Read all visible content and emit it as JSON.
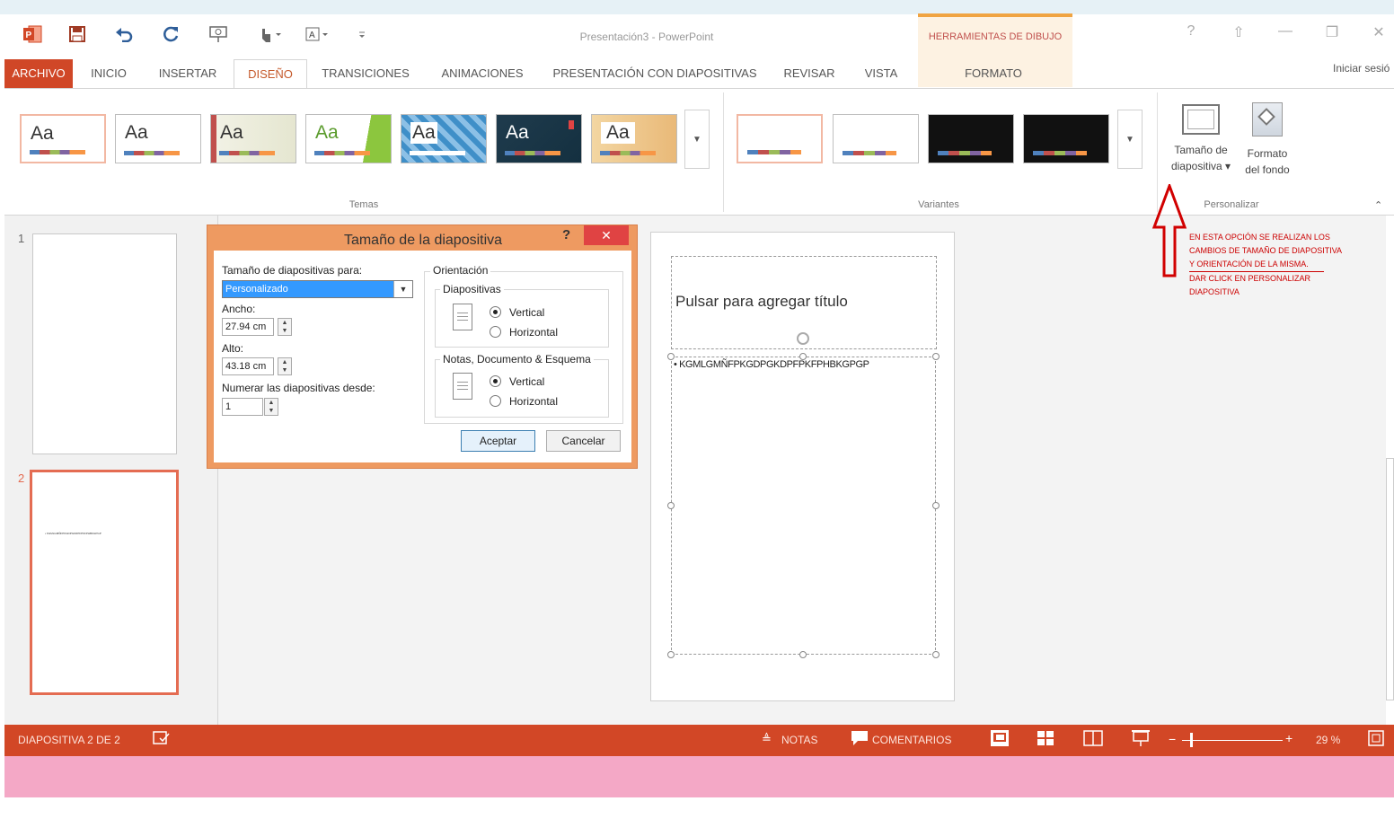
{
  "titlebar": {
    "title": "Presentación3 - PowerPoint",
    "context_group": "HERRAMIENTAS DE DIBUJO",
    "quick_access_icons": [
      "powerpoint-logo-icon",
      "save-icon",
      "undo-icon",
      "redo-icon",
      "start-from-beginning-icon",
      "touch-mode-icon",
      "font-size-icon",
      "customize-qat-icon"
    ],
    "window_buttons": [
      "?",
      "⇧",
      "—",
      "❐",
      "✕"
    ]
  },
  "tabs": [
    "ARCHIVO",
    "INICIO",
    "INSERTAR",
    "DISEÑO",
    "TRANSICIONES",
    "ANIMACIONES",
    "PRESENTACIÓN CON DIAPOSITIVAS",
    "REVISAR",
    "VISTA",
    "FORMATO"
  ],
  "active_tab": "DISEÑO",
  "signin": "Iniciar sesió",
  "ribbon": {
    "themes_label": "Temas",
    "themes": [
      "Aa",
      "Aa",
      "Aa",
      "Aa",
      "Aa",
      "Aa",
      "Aa"
    ],
    "variants_label": "Variantes",
    "customize_label": "Personalizar",
    "slide_size_line1": "Tamaño de",
    "slide_size_line2": "diapositiva ▾",
    "bg_format_line1": "Formato",
    "bg_format_line2": "del fondo"
  },
  "thumbnails": [
    {
      "num": "1",
      "text": ""
    },
    {
      "num": "2",
      "text": "• KGMLGMÑFPKGDPGKDPFPKFPHBKGPGP"
    }
  ],
  "slide": {
    "title_placeholder": "Pulsar para agregar título",
    "body_text": "• KGMLGMÑFPKGDPGKDPFPKFPHBKGPGP"
  },
  "dialog": {
    "title": "Tamaño de la diapositiva",
    "help": "?",
    "close": "✕",
    "size_for_label": "Tamaño de diapositivas para:",
    "size_for_value": "Personalizado",
    "width_label": "Ancho:",
    "width_value": "27.94 cm",
    "height_label": "Alto:",
    "height_value": "43.18 cm",
    "number_from_label": "Numerar las diapositivas desde:",
    "number_from_value": "1",
    "orientation_label": "Orientación",
    "slides_label": "Diapositivas",
    "notes_label": "Notas, Documento & Esquema",
    "vertical": "Vertical",
    "horizontal": "Horizontal",
    "slides_orientation": "vertical",
    "notes_orientation": "vertical",
    "ok": "Aceptar",
    "cancel": "Cancelar"
  },
  "annotation": {
    "lines": [
      "EN ESTA OPCIÓN SE REALIZAN LOS",
      "CAMBIOS DE TAMAÑO DE DIAPOSITIVA",
      "Y ORIENTACIÓN DE LA MISMA.",
      "DAR CLICK EN PERSONALIZAR",
      "DIAPOSITIVA"
    ],
    "color": "#cc0000"
  },
  "statusbar": {
    "slide_info": "DIAPOSITIVA 2 DE 2",
    "notes": "NOTAS",
    "comments": "COMENTARIOS",
    "zoom": "29 %",
    "color": "#d24726"
  }
}
